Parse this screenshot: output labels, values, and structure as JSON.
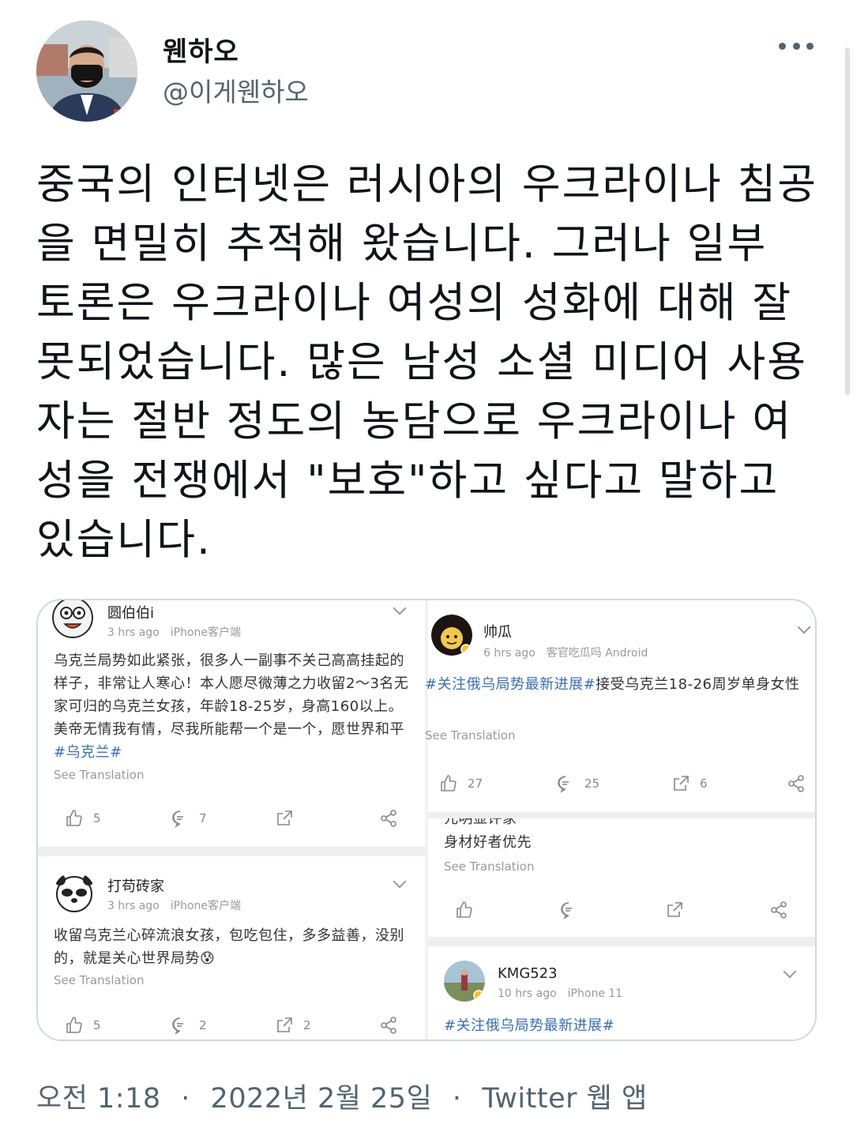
{
  "author": {
    "name": "웬하오",
    "handle": "@이게웬하오"
  },
  "tweet": {
    "text": "중국의 인터넷은 러시아의 우크라이나 침공을 면밀히 추적해 왔습니다. 그러나 일부 토론은 우크라이나 여성의 성화에 대해 잘못되었습니다. 많은 남성 소셜 미디어 사용자는 절반 정도의 농담으로 우크라이나 여성을 전쟁에서 \"보호\"하고 싶다고 말하고 있습니다."
  },
  "screenshot": {
    "see_translation": "See Translation",
    "posts": [
      {
        "name": "圆伯伯i",
        "time": "3 hrs ago",
        "client": "iPhone客户端",
        "body": "乌克兰局势如此紧张，很多人一副事不关己高高挂起的样子，非常让人寒心！本人愿尽微薄之力收留2～3名无家可归的乌克兰女孩，年龄18-25岁，身高160以上。美帝无情我有情，尽我所能帮一个是一个，愿世界和平",
        "hashtag": "#乌克兰#",
        "likes": "5",
        "comments": "7"
      },
      {
        "name": "打苟砖家",
        "time": "3 hrs ago",
        "client": "iPhone客户端",
        "body": "收留乌克兰心碎流浪女孩，包吃包住，多多益善，没别的，就是关心世界局势😰",
        "likes": "5",
        "comments": "2",
        "reposts": "2"
      },
      {
        "name": "帅瓜",
        "time": "6 hrs ago",
        "client": "客官吃瓜吗 Android",
        "hashtag": "#关注俄乌局势最新进展#",
        "body": "接受乌克兰18-26周岁单身女性",
        "likes": "27",
        "comments": "25",
        "reposts": "6"
      },
      {
        "cut_top": "元明显评家",
        "body": "身材好者优先"
      },
      {
        "name": "KMG523",
        "time": "10 hrs ago",
        "client": "iPhone 11",
        "hashtag": "#关注俄乌局势最新进展#"
      }
    ]
  },
  "footer": {
    "time": "오전 1:18",
    "date": "2022년 2월 25일",
    "source": "Twitter 웹 앱",
    "sep": "·"
  }
}
